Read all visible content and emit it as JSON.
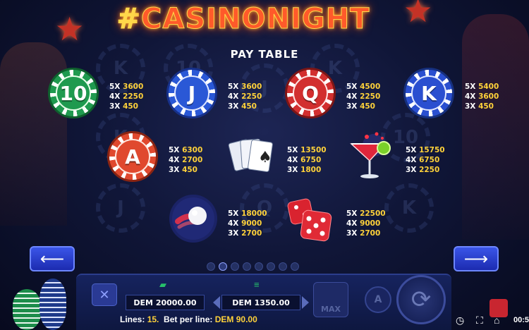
{
  "logo": {
    "hash": "#",
    "text": "CASINONIGHT"
  },
  "paytable": {
    "title": "PAY TABLE",
    "symbols": [
      {
        "symbol": "10",
        "kind": "chip",
        "color": "#1f9a4f",
        "pays": [
          {
            "k": "5X",
            "v": "3600"
          },
          {
            "k": "4X",
            "v": "2250"
          },
          {
            "k": "3X",
            "v": "450"
          }
        ]
      },
      {
        "symbol": "J",
        "kind": "chip",
        "color": "#2a58d6",
        "pays": [
          {
            "k": "5X",
            "v": "3600"
          },
          {
            "k": "4X",
            "v": "2250"
          },
          {
            "k": "3X",
            "v": "450"
          }
        ]
      },
      {
        "symbol": "Q",
        "kind": "chip",
        "color": "#d22f2f",
        "pays": [
          {
            "k": "5X",
            "v": "4500"
          },
          {
            "k": "4X",
            "v": "2250"
          },
          {
            "k": "3X",
            "v": "450"
          }
        ]
      },
      {
        "symbol": "K",
        "kind": "chip",
        "color": "#2a4fd0",
        "pays": [
          {
            "k": "5X",
            "v": "5400"
          },
          {
            "k": "4X",
            "v": "3600"
          },
          {
            "k": "3X",
            "v": "450"
          }
        ]
      },
      {
        "symbol": "A",
        "kind": "chip",
        "color": "#e0492e",
        "pays": [
          {
            "k": "5X",
            "v": "6300"
          },
          {
            "k": "4X",
            "v": "2700"
          },
          {
            "k": "3X",
            "v": "450"
          }
        ]
      },
      {
        "symbol": "cards-icon",
        "kind": "cards",
        "pays": [
          {
            "k": "5X",
            "v": "13500"
          },
          {
            "k": "4X",
            "v": "6750"
          },
          {
            "k": "3X",
            "v": "1800"
          }
        ]
      },
      {
        "symbol": "cocktail-icon",
        "kind": "cocktail",
        "pays": [
          {
            "k": "5X",
            "v": "15750"
          },
          {
            "k": "4X",
            "v": "6750"
          },
          {
            "k": "3X",
            "v": "2250"
          }
        ]
      },
      {
        "symbol": "roulette-ball-icon",
        "kind": "ball",
        "pays": [
          {
            "k": "5X",
            "v": "18000"
          },
          {
            "k": "4X",
            "v": "9000"
          },
          {
            "k": "3X",
            "v": "2700"
          }
        ]
      },
      {
        "symbol": "dice-icon",
        "kind": "dice",
        "pays": [
          {
            "k": "5X",
            "v": "22500"
          },
          {
            "k": "4X",
            "v": "9000"
          },
          {
            "k": "3X",
            "v": "2700"
          }
        ]
      }
    ]
  },
  "pagination": {
    "pages": 8,
    "current": 2
  },
  "controls": {
    "close_label": "✕",
    "balance": "DEM 20000.00",
    "total_bet": "DEM 1350.00",
    "max_label": "MAX",
    "auto_label": "A",
    "lines_label": "Lines:",
    "lines_value": "15.",
    "bet_label": "Bet per line:",
    "bet_value": "DEM 90.00"
  },
  "clock": "00:5"
}
